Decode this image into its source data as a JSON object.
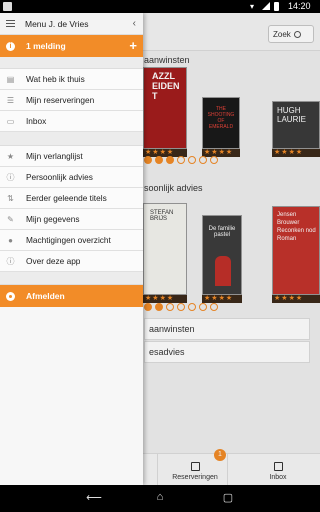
{
  "status": {
    "time": "14:20"
  },
  "underlay": {
    "search_label": "Zoek",
    "section1_title": "aanwinsten",
    "section2_title": "soonlijk advies",
    "link1": "aanwinsten",
    "link2": "esadvies",
    "tabs": [
      {
        "label": "Reserveringen"
      },
      {
        "label": "Inbox"
      }
    ],
    "badge": "1",
    "covers": [
      {
        "text": "AZZL\nEIDEN\nT"
      },
      {
        "text": "THE SHOOTING OF EMERALD"
      },
      {
        "text": "HUGH LAURIE"
      },
      {
        "text": "STEFAN BRIJS"
      },
      {
        "text": "De familie pastel"
      },
      {
        "text": "Jensen Brouwer Reconken nod Roman"
      }
    ]
  },
  "drawer": {
    "title": "Menu J. de Vries",
    "notification": "1 melding",
    "items_group1": [
      {
        "label": "Wat heb ik thuis",
        "icon": "book-icon"
      },
      {
        "label": "Mijn reserveringen",
        "icon": "list-icon"
      },
      {
        "label": "Inbox",
        "icon": "inbox-icon"
      }
    ],
    "items_group2": [
      {
        "label": "Mijn verlanglijst",
        "icon": "star-icon"
      },
      {
        "label": "Persoonlijk advies",
        "icon": "info-icon"
      },
      {
        "label": "Eerder geleende titels",
        "icon": "sort-icon"
      },
      {
        "label": "Mijn gegevens",
        "icon": "edit-icon"
      },
      {
        "label": "Machtigingen overzicht",
        "icon": "people-icon"
      },
      {
        "label": "Over deze app",
        "icon": "info-icon"
      }
    ],
    "logout": "Afmelden"
  },
  "colors": {
    "accent": "#f28c28"
  }
}
